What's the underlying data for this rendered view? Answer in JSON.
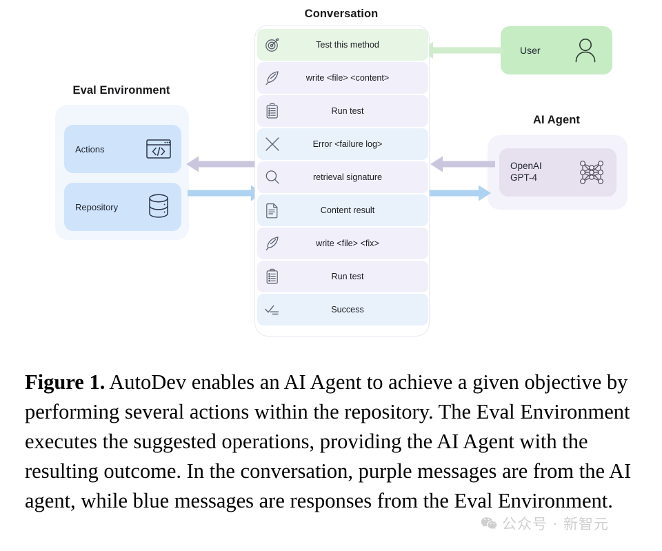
{
  "figure": {
    "caption_prefix": "Figure 1.",
    "caption_body": " AutoDev enables an AI Agent to achieve a given objective by performing several actions within the repository. The Eval Environment executes the suggested operations, providing the AI Agent with the resulting outcome. In the conversation, purple messages are from the AI agent, while blue messages are responses from the Eval Environment."
  },
  "conversation": {
    "title": "Conversation",
    "messages": [
      {
        "text": "Test this method",
        "icon": "target-icon",
        "source": "user"
      },
      {
        "text": "write <file> <content>",
        "icon": "quill-icon",
        "source": "agent"
      },
      {
        "text": "Run test",
        "icon": "clipboard-icon",
        "source": "agent"
      },
      {
        "text": "Error <failure log>",
        "icon": "x-icon",
        "source": "env"
      },
      {
        "text": "retrieval signature",
        "icon": "search-icon",
        "source": "agent"
      },
      {
        "text": "Content result",
        "icon": "document-icon",
        "source": "env"
      },
      {
        "text": "write <file> <fix>",
        "icon": "quill-icon",
        "source": "agent"
      },
      {
        "text": "Run test",
        "icon": "clipboard-icon",
        "source": "agent"
      },
      {
        "text": "Success",
        "icon": "checklist-icon",
        "source": "env"
      }
    ]
  },
  "eval_environment": {
    "title": "Eval Environment",
    "cards": [
      {
        "label": "Actions",
        "icon": "code-window-icon"
      },
      {
        "label": "Repository",
        "icon": "database-icon"
      }
    ]
  },
  "user": {
    "label": "User",
    "icon": "person-icon"
  },
  "ai_agent": {
    "title": "AI Agent",
    "model": "OpenAI\nGPT-4",
    "icon": "neural-network-icon"
  },
  "watermark": {
    "text": "公众号 · 新智元",
    "icon": "wechat-icon"
  },
  "colors": {
    "user_message": "#e6f5e4",
    "agent_message": "#f1f0fa",
    "env_message": "#e9f2fb",
    "eval_card": "#cfe4fb",
    "eval_panel": "#f2f6fd",
    "user_box": "#c5ecc2",
    "agent_card": "#e7e0ef",
    "agent_panel": "#f4f2fa",
    "arrow_purple": "#c9c6dd",
    "arrow_blue": "#aed2f2",
    "arrow_green": "#cfeccb"
  }
}
